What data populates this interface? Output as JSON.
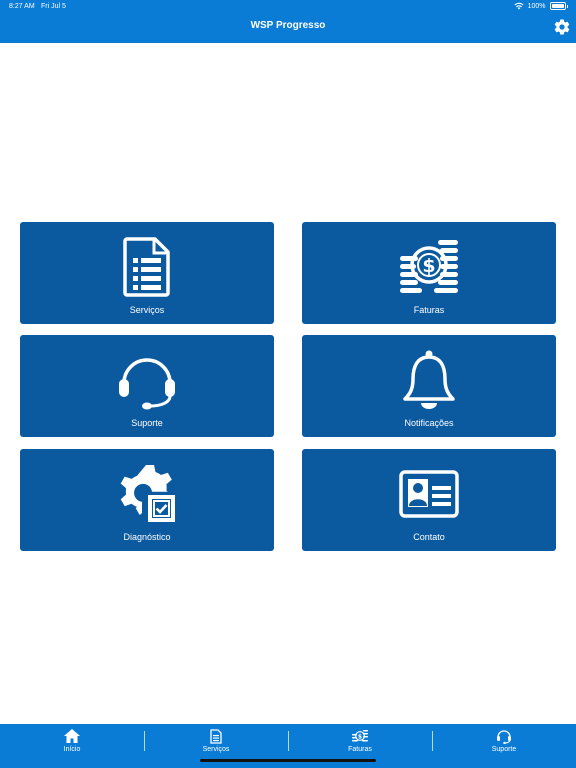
{
  "status_bar": {
    "time": "8:27 AM",
    "date": "Fri Jul 5",
    "battery": "100%"
  },
  "header": {
    "title": "WSP Progresso",
    "settings_icon": "gear-icon"
  },
  "tiles": [
    {
      "label": "Serviços",
      "icon": "document-list-icon"
    },
    {
      "label": "Faturas",
      "icon": "coins-dollar-icon"
    },
    {
      "label": "Suporte",
      "icon": "headset-icon"
    },
    {
      "label": "Notificações",
      "icon": "bell-icon"
    },
    {
      "label": "Diagnóstico",
      "icon": "gear-check-icon"
    },
    {
      "label": "Contato",
      "icon": "contact-card-icon"
    }
  ],
  "tabbar": {
    "items": [
      {
        "label": "Início",
        "icon": "home-icon"
      },
      {
        "label": "Serviços",
        "icon": "document-icon"
      },
      {
        "label": "Faturas",
        "icon": "coins-icon"
      },
      {
        "label": "Suporte",
        "icon": "headset-icon"
      }
    ]
  },
  "colors": {
    "header": "#0a7cd6",
    "tile": "#0b5aa0",
    "text": "#ffffff"
  }
}
